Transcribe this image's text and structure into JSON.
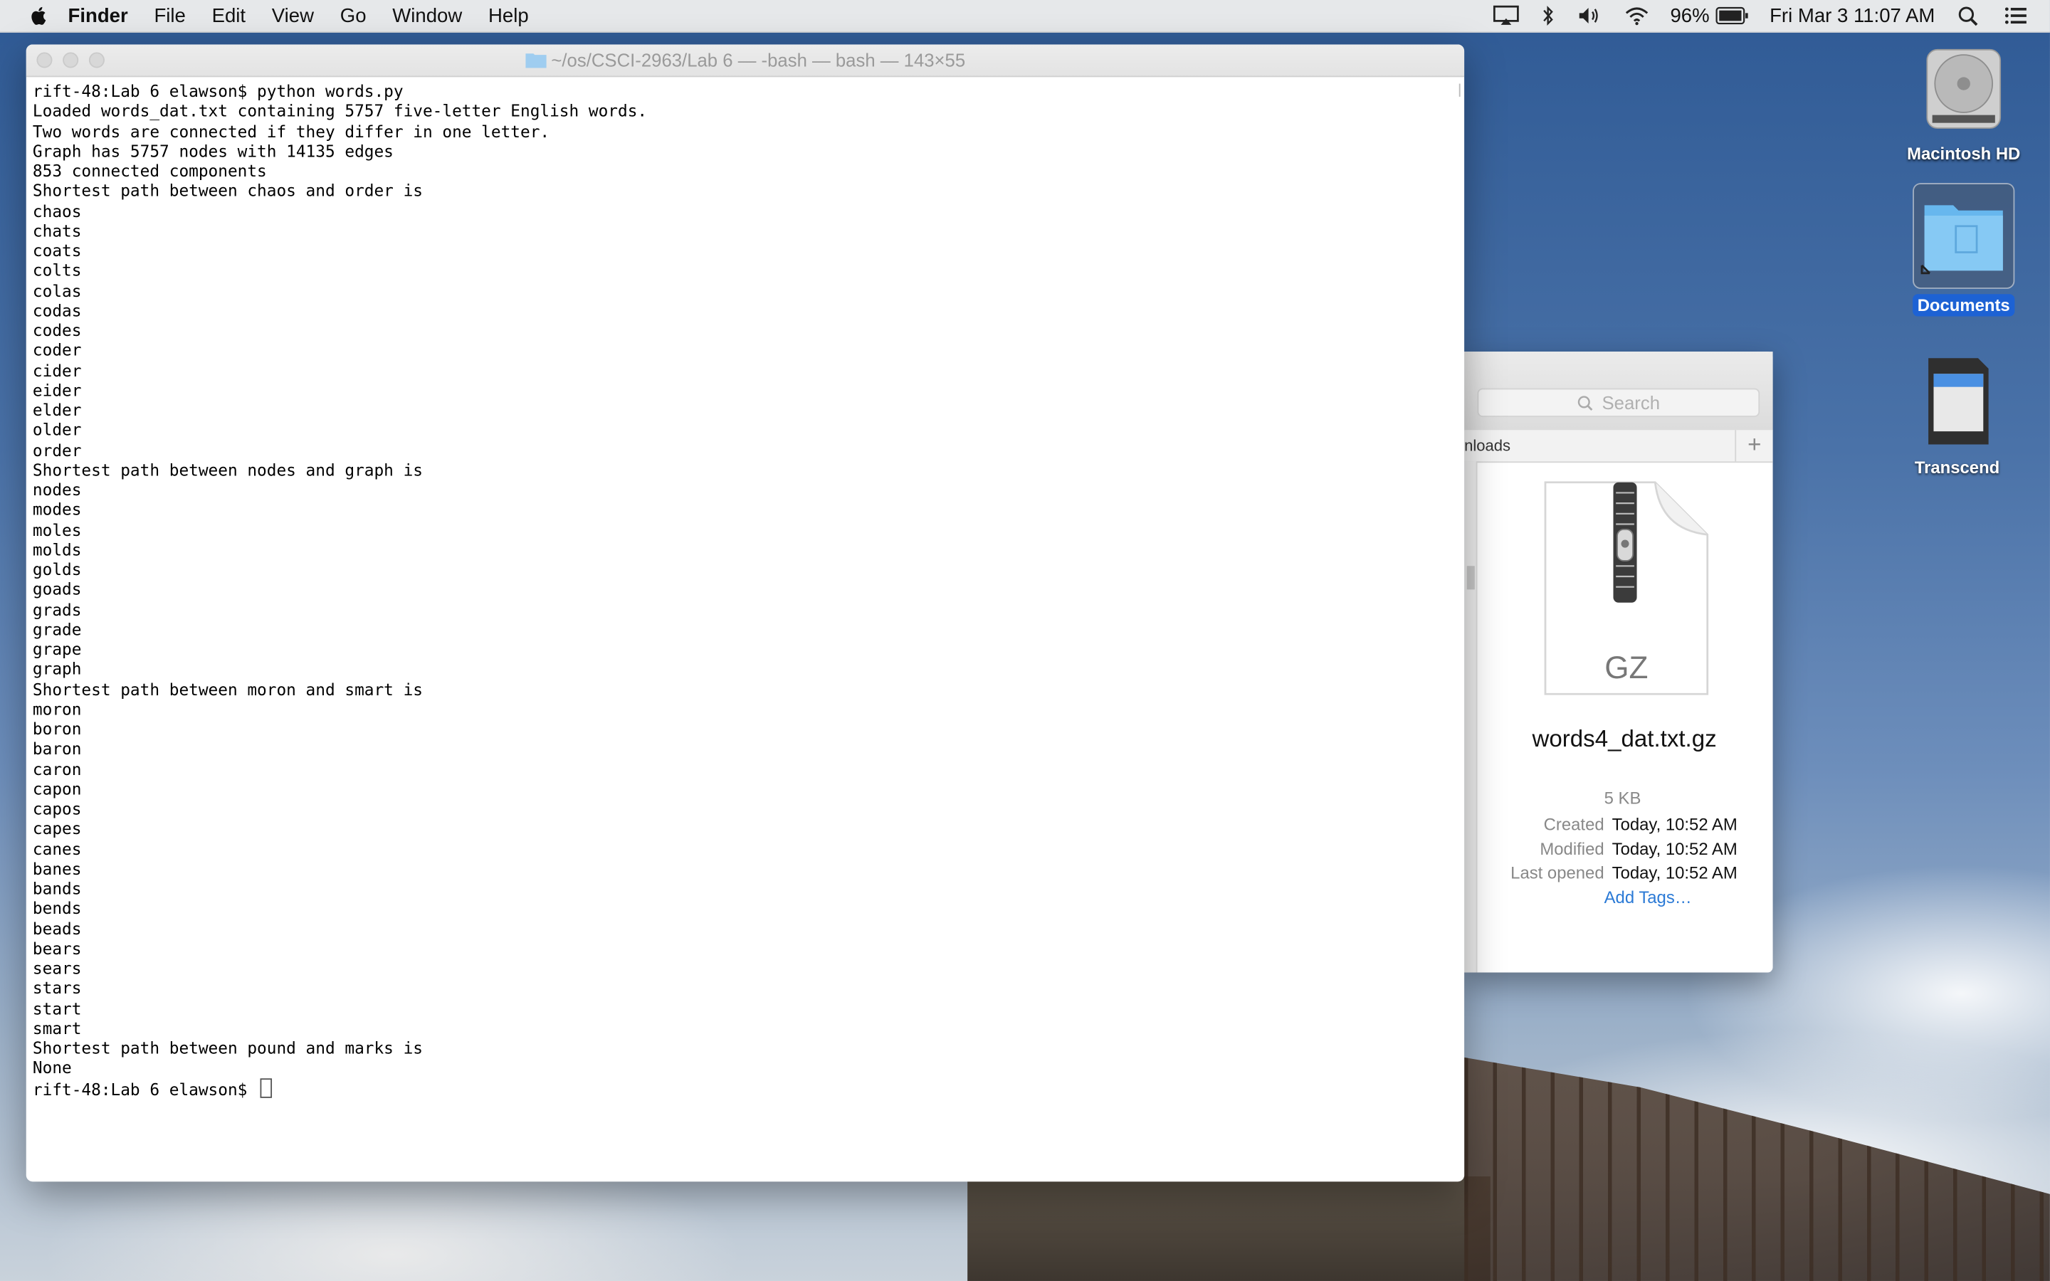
{
  "menubar": {
    "app_name": "Finder",
    "items": [
      "File",
      "Edit",
      "View",
      "Go",
      "Window",
      "Help"
    ],
    "battery": "96%",
    "clock": "Fri Mar 3  11:07 AM",
    "icons": [
      "apple-icon",
      "airplay-icon",
      "bluetooth-icon",
      "volume-icon",
      "wifi-icon",
      "battery-icon",
      "spotlight-icon",
      "notification-center-icon"
    ]
  },
  "terminal": {
    "title": "~/os/CSCI-2963/Lab 6 — -bash — bash — 143×55",
    "lines": [
      "rift-48:Lab 6 elawson$ python words.py",
      "Loaded words_dat.txt containing 5757 five-letter English words.",
      "Two words are connected if they differ in one letter.",
      "Graph has 5757 nodes with 14135 edges",
      "853 connected components",
      "Shortest path between chaos and order is",
      "chaos",
      "chats",
      "coats",
      "colts",
      "colas",
      "codas",
      "codes",
      "coder",
      "cider",
      "eider",
      "elder",
      "older",
      "order",
      "Shortest path between nodes and graph is",
      "nodes",
      "modes",
      "moles",
      "molds",
      "golds",
      "goads",
      "grads",
      "grade",
      "grape",
      "graph",
      "Shortest path between moron and smart is",
      "moron",
      "boron",
      "baron",
      "caron",
      "capon",
      "capos",
      "capes",
      "canes",
      "banes",
      "bands",
      "bends",
      "beads",
      "bears",
      "sears",
      "stars",
      "start",
      "smart",
      "Shortest path between pound and marks is",
      "None"
    ],
    "prompt": "rift-48:Lab 6 elawson$ "
  },
  "finder": {
    "search_placeholder": "Search",
    "tab_label": "nloads",
    "file_type_label": "GZ",
    "filename": "words4_dat.txt.gz",
    "size": "5 KB",
    "meta": [
      {
        "key": "Created",
        "value": "Today, 10:52 AM"
      },
      {
        "key": "Modified",
        "value": "Today, 10:52 AM"
      },
      {
        "key": "Last opened",
        "value": "Today, 10:52 AM"
      }
    ],
    "add_tags": "Add Tags…"
  },
  "desktop": {
    "icons": [
      {
        "label": "Macintosh HD"
      },
      {
        "label": "Documents"
      },
      {
        "label": "Transcend"
      }
    ]
  }
}
